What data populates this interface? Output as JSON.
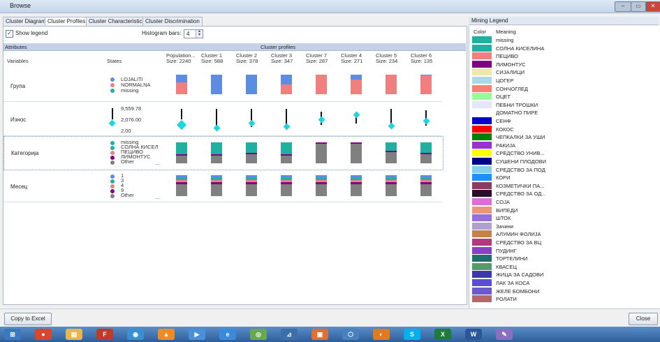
{
  "window": {
    "title": "Browse",
    "controls": [
      "–",
      "▭",
      "✕"
    ]
  },
  "tabs": [
    {
      "label": "Cluster Diagram"
    },
    {
      "label": "Cluster Profiles",
      "active": true
    },
    {
      "label": "Cluster Characteristics"
    },
    {
      "label": "Cluster Discrimination"
    }
  ],
  "toolbar": {
    "show_legend_label": "Show legend",
    "show_legend_checked": true,
    "histogram_label": "Histogram bars:",
    "histogram_value": "4"
  },
  "profiles": {
    "section_header": "Cluster profiles",
    "attributes_header": "Attributes",
    "variables_header": "Variables",
    "states_header": "States",
    "columns": [
      {
        "name": "Population...",
        "size": "Size: 2240"
      },
      {
        "name": "Cluster 1",
        "size": "Size: 588"
      },
      {
        "name": "Cluster 2",
        "size": "Size: 378"
      },
      {
        "name": "Cluster 3",
        "size": "Size: 347"
      },
      {
        "name": "Cluster 7",
        "size": "Size: 287"
      },
      {
        "name": "Cluster 4",
        "size": "Size: 271"
      },
      {
        "name": "Cluster 5",
        "size": "Size: 234"
      },
      {
        "name": "Cluster 6",
        "size": "Size: 135"
      }
    ],
    "rows": [
      {
        "variable": "Група",
        "states": [
          "LOJALITI",
          "NORMALNA",
          "missing"
        ],
        "state_colors": [
          "#5b8de0",
          "#f08080",
          "#20b0a0"
        ]
      },
      {
        "variable": "Износ",
        "states": [
          "9,559.78",
          "2,076.00",
          "2.00"
        ]
      },
      {
        "variable": "Категорија",
        "states": [
          "missing",
          "СОЛНА КИСЕЛ",
          "ПЕЦИВО",
          "ЛИМОНТУС",
          "Other"
        ],
        "more": "...",
        "state_colors": [
          "#20b0a0",
          "#20b0a0",
          "#f08080",
          "#800080",
          "#808080"
        ]
      },
      {
        "variable": "Месец",
        "states": [
          "1",
          "3",
          "4",
          "9",
          "Other"
        ],
        "more": "...",
        "state_colors": [
          "#5b8de0",
          "#20b0a0",
          "#f08080",
          "#800080",
          "#808080"
        ]
      }
    ]
  },
  "grupa_bars": [
    {
      "blue": 0.4,
      "pink": 0.6
    },
    {
      "blue": 1.0,
      "pink": 0.0
    },
    {
      "blue": 1.0,
      "pink": 0.0
    },
    {
      "blue": 0.5,
      "pink": 0.5
    },
    {
      "blue": 0.0,
      "pink": 1.0
    },
    {
      "blue": 0.25,
      "pink": 0.75
    },
    {
      "blue": 0.0,
      "pink": 1.0
    },
    {
      "blue": 0.05,
      "pink": 0.95
    }
  ],
  "iznos_marks": [
    {
      "line_top": 0.1,
      "line_bottom": 0.55,
      "diamond": 0.75
    },
    {
      "line_top": 0.1,
      "line_bottom": 0.85,
      "diamond": 0.9
    },
    {
      "line_top": 0.1,
      "line_bottom": 0.85,
      "diamond": 0.7
    },
    {
      "line_top": 0.1,
      "line_bottom": 0.85,
      "diamond": 0.85
    },
    {
      "line_top": 0.2,
      "line_bottom": 0.75,
      "diamond": 0.55
    },
    {
      "line_top": 0.25,
      "line_bottom": 0.7,
      "diamond": 0.35
    },
    {
      "line_top": 0.1,
      "line_bottom": 0.85,
      "diamond": 0.8
    },
    {
      "line_top": 0.15,
      "line_bottom": 0.8,
      "diamond": 0.6
    }
  ],
  "kategorija_bars": [
    {
      "teal": 0.55,
      "pink": 0.0,
      "gray": 0.45
    },
    {
      "teal": 0.55,
      "pink": 0.0,
      "gray": 0.45
    },
    {
      "teal": 0.5,
      "pink": 0.0,
      "gray": 0.5
    },
    {
      "teal": 0.55,
      "pink": 0.0,
      "gray": 0.45
    },
    {
      "teal": 0.0,
      "pink": 0.0,
      "gray": 1.0
    },
    {
      "teal": 0.0,
      "pink": 0.0,
      "gray": 1.0
    },
    {
      "teal": 0.4,
      "pink": 0.0,
      "gray": 0.6
    },
    {
      "teal": 0.5,
      "pink": 0.0,
      "gray": 0.5
    }
  ],
  "legend": {
    "title": "Mining Legend",
    "color_header": "Color",
    "meaning_header": "Meaning",
    "items": [
      {
        "color": "#20b0a0",
        "label": "missing"
      },
      {
        "color": "#20b0a0",
        "label": "СОЛНА КИСЕЛИНА"
      },
      {
        "color": "#f08080",
        "label": "ПЕЦИВО"
      },
      {
        "color": "#800080",
        "label": "ЛИМОНТУС"
      },
      {
        "color": "#eee8aa",
        "label": "СИЈАЛИЦИ"
      },
      {
        "color": "#add8e6",
        "label": "ЦОГЕР"
      },
      {
        "color": "#fa8072",
        "label": "СОНЧОГЛЕД"
      },
      {
        "color": "#98fb98",
        "label": "ОЦЕТ"
      },
      {
        "color": "#e6e6fa",
        "label": "ПЕБНИ ТРОШКИ"
      },
      {
        "color": "#ffffff",
        "label": "ДОМАТНО ПИРЕ"
      },
      {
        "color": "#0000cd",
        "label": "СЕНФ"
      },
      {
        "color": "#ff0000",
        "label": "КОКОС"
      },
      {
        "color": "#008000",
        "label": "ЧЕПКАЛКИ ЗА УШИ"
      },
      {
        "color": "#9932cc",
        "label": "РАКИЈА"
      },
      {
        "color": "#ffff00",
        "label": "СРЕДСТВО УНИВ..."
      },
      {
        "color": "#00008b",
        "label": "СУШЕНИ ПЛОДОВИ"
      },
      {
        "color": "#87ceeb",
        "label": "СРЕДСТВО ЗА ПОД"
      },
      {
        "color": "#1e90ff",
        "label": "КОРИ"
      },
      {
        "color": "#8b3a62",
        "label": "КОЗМЕТИЧКИ ПА..."
      },
      {
        "color": "#2f0a2f",
        "label": "СРЕДСТВО ЗА ОД..."
      },
      {
        "color": "#da70d6",
        "label": "СОЈА"
      },
      {
        "color": "#e9967a",
        "label": "ВИПЕДИ"
      },
      {
        "color": "#9370db",
        "label": "ШТОК"
      },
      {
        "color": "#b0a0d0",
        "label": "Зачини"
      },
      {
        "color": "#c8804a",
        "label": "АЛУМИН ФОЛИЈА"
      },
      {
        "color": "#b03a7a",
        "label": "СРЕДСТВО ЗА ВЦ"
      },
      {
        "color": "#8a3fc7",
        "label": "ПУДИНГ"
      },
      {
        "color": "#1f6f6a",
        "label": "ТОРТЕЛИНИ"
      },
      {
        "color": "#5a9a6a",
        "label": "КВАСЕЦ"
      },
      {
        "color": "#3b3aa8",
        "label": "ЖИЦА ЗА САДОВИ"
      },
      {
        "color": "#5a4fd0",
        "label": "ЛАК ЗА КОСА"
      },
      {
        "color": "#6a5acd",
        "label": "ЖЕЛЕ БОМБОНИ"
      },
      {
        "color": "#b06a6a",
        "label": "РОЛАТИ"
      }
    ]
  },
  "bottom": {
    "copy_label": "Copy to Excel",
    "close_label": "Close"
  },
  "taskbar": {
    "icons": [
      {
        "name": "start-icon",
        "color": "#3a78c0",
        "glyph": "⊞"
      },
      {
        "name": "chrome-icon",
        "color": "#d9472b",
        "glyph": "●"
      },
      {
        "name": "explorer-icon",
        "color": "#e6b84a",
        "glyph": "▤"
      },
      {
        "name": "filezilla-icon",
        "color": "#c0392b",
        "glyph": "F"
      },
      {
        "name": "app-icon",
        "color": "#3a8fd0",
        "glyph": "◉"
      },
      {
        "name": "vlc-icon",
        "color": "#f08a24",
        "glyph": "▲"
      },
      {
        "name": "media-icon",
        "color": "#4a90d9",
        "glyph": "▶"
      },
      {
        "name": "ie-icon",
        "color": "#3b8bdc",
        "glyph": "e"
      },
      {
        "name": "network-icon",
        "color": "#6aa84f",
        "glyph": "◎"
      },
      {
        "name": "analysis-icon",
        "color": "#3d6fa8",
        "glyph": "⊿"
      },
      {
        "name": "app2-icon",
        "color": "#e07030",
        "glyph": "▣"
      },
      {
        "name": "box-icon",
        "color": "#4a7fc0",
        "glyph": "⬡"
      },
      {
        "name": "firefox-icon",
        "color": "#e07a1f",
        "glyph": "◐"
      },
      {
        "name": "skype-icon",
        "color": "#00aff0",
        "glyph": "S"
      },
      {
        "name": "excel-icon",
        "color": "#1f7a3d",
        "glyph": "X"
      },
      {
        "name": "word-icon",
        "color": "#2b5797",
        "glyph": "W"
      },
      {
        "name": "paint-icon",
        "color": "#8a6fbf",
        "glyph": "✎"
      }
    ]
  }
}
